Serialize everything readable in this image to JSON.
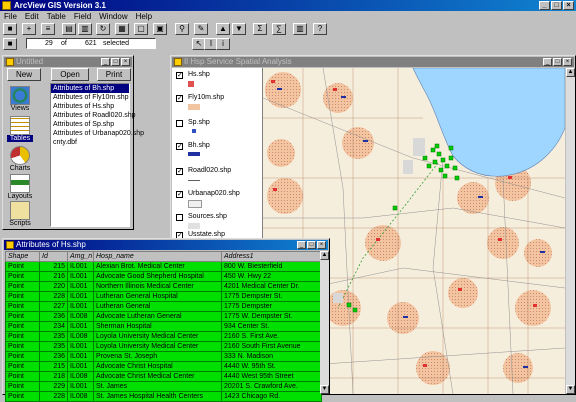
{
  "app": {
    "title": "ArcView GIS Version 3.1"
  },
  "menu": [
    "File",
    "Edit",
    "Table",
    "Field",
    "Window",
    "Help"
  ],
  "toolbar2": {
    "selected_count": "29",
    "of_label": "of",
    "total": "621",
    "selected_label": "selected"
  },
  "project": {
    "title": "Untitled",
    "buttons": {
      "new": "New",
      "open": "Open",
      "print": "Print"
    },
    "docs": [
      "Views",
      "Tables",
      "Charts",
      "Layouts",
      "Scripts"
    ],
    "tables": [
      "Attributes of Bh.shp",
      "Attributes of Fly10m.shp",
      "Attributes of Hs.shp",
      "Attributes of Roadl020.shp",
      "Attributes of Sp.shp",
      "Attributes of Urbanap020.shp",
      "cnty.dbf"
    ]
  },
  "view": {
    "title": "Il Hsp Service Spatial Analysis",
    "layers": [
      {
        "name": "Hs.shp",
        "checked": true
      },
      {
        "name": "Fly10m.shp",
        "checked": true
      },
      {
        "name": "Sp.shp",
        "checked": false
      },
      {
        "name": "Bh.shp",
        "checked": true
      },
      {
        "name": "Roadl020.shp",
        "checked": true
      },
      {
        "name": "Urbanap020.shp",
        "checked": true
      },
      {
        "name": "Sources.shp",
        "checked": false
      },
      {
        "name": "Usstate.shp",
        "checked": true
      }
    ],
    "colors": {
      "lake": "#9ed6ff",
      "land": "#f6eedd",
      "urban": "#f2c4a0",
      "hospital": "#00cc00"
    }
  },
  "table": {
    "title": "Attributes of Hs.shp",
    "columns": [
      "Shape",
      "Id",
      "Amg_n",
      "Hosp_name",
      "Address1"
    ],
    "rows": [
      [
        "Point",
        "215",
        "IL001",
        "Alexian Brot. Medical Center",
        "800 W. Biesterfield"
      ],
      [
        "Point",
        "216",
        "IL001",
        "Advocate Good Shepherd Hospital",
        "450 W. Hwy 22"
      ],
      [
        "Point",
        "220",
        "IL001",
        "Northern Illinois Medical Center",
        "4201 Medical Center Dr."
      ],
      [
        "Point",
        "228",
        "IL001",
        "Lutheran General Hospital",
        "1775 Dempster St."
      ],
      [
        "Point",
        "227",
        "IL001",
        "Lutheran General",
        "1775 Dempster"
      ],
      [
        "Point",
        "236",
        "IL008",
        "Advocate Lutheran General",
        "1775 W. Dempster St."
      ],
      [
        "Point",
        "234",
        "IL001",
        "Sherman Hospital",
        "934 Center St."
      ],
      [
        "Point",
        "235",
        "IL008",
        "Loyola University Medical Center",
        "2160 S. First Ave."
      ],
      [
        "Point",
        "235",
        "IL001",
        "Loyola University Medical Center",
        "2160 South First Avenue"
      ],
      [
        "Point",
        "236",
        "IL001",
        "Provena St. Joseph",
        "333 N. Madison"
      ],
      [
        "Point",
        "215",
        "IL001",
        "Advocate Christ Hospital",
        "4440 W. 95th St."
      ],
      [
        "Point",
        "218",
        "IL008",
        "Advocate Christ Medical Center",
        "4440 West 95th Street"
      ],
      [
        "Point",
        "229",
        "IL001",
        "St. James",
        "20201 S. Crawford Ave."
      ],
      [
        "Point",
        "228",
        "IL008",
        "St. James Hospital Health Centers",
        "1423 Chicago Rd."
      ]
    ]
  }
}
